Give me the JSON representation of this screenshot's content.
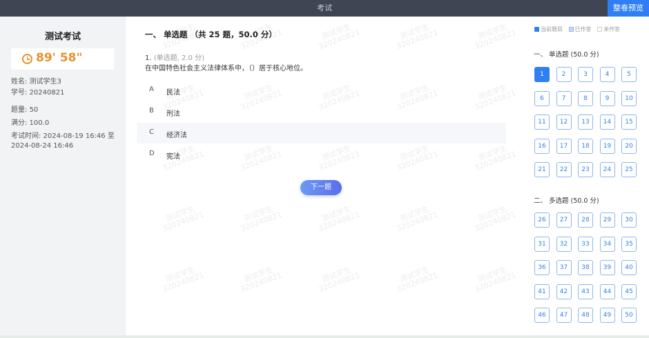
{
  "topbar": {
    "title": "考试",
    "preview_button": "整卷预览"
  },
  "left": {
    "exam_name": "测试考试",
    "timer": "89' 58\"",
    "name_line": "姓名: 测试学生3",
    "id_line": "学号: 20240821",
    "count_line": "题量: 50",
    "score_line": "满分: 100.0",
    "time_line1": "考试时间: 2024-08-19 16:46 至",
    "time_line2": "2024-08-24 16:46"
  },
  "main": {
    "section_title": "一、 单选题 （共 25 题，50.0 分）",
    "question_number": "1.",
    "question_meta": "(单选题, 2.0 分)",
    "question_text": "在中国特色社会主义法律体系中，（）居于核心地位。",
    "options": [
      {
        "letter": "A",
        "text": "民法"
      },
      {
        "letter": "B",
        "text": "刑法"
      },
      {
        "letter": "C",
        "text": "经济法"
      },
      {
        "letter": "D",
        "text": "宪法"
      }
    ],
    "next_button": "下一题",
    "watermark_line1": "测试学生",
    "watermark_line2": "320240821"
  },
  "right": {
    "legend": {
      "current": "当前题目",
      "answered": "已作答",
      "unanswered": "未作答"
    },
    "groups": [
      {
        "title": "一、 单选题   (50.0 分)",
        "numbers": [
          "1",
          "2",
          "3",
          "4",
          "5",
          "6",
          "7",
          "8",
          "9",
          "10",
          "11",
          "12",
          "13",
          "14",
          "15",
          "16",
          "17",
          "18",
          "19",
          "20",
          "21",
          "22",
          "23",
          "24",
          "25"
        ]
      },
      {
        "title": "二、 多选题   (50.0 分)",
        "numbers": [
          "26",
          "27",
          "28",
          "29",
          "30",
          "31",
          "32",
          "33",
          "34",
          "35",
          "36",
          "37",
          "38",
          "39",
          "40",
          "41",
          "42",
          "43",
          "44",
          "45",
          "46",
          "47",
          "48",
          "49",
          "50"
        ]
      }
    ]
  },
  "colors": {
    "accent": "#2f7ff3",
    "timer": "#e8912e",
    "topbar": "#3f4553"
  }
}
